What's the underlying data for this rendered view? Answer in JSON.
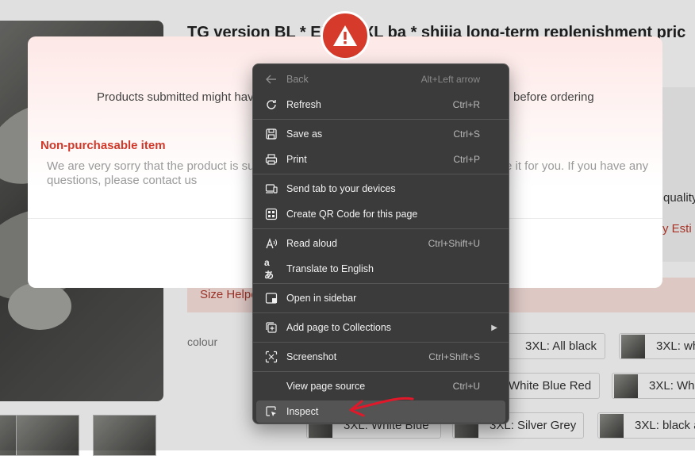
{
  "product": {
    "title": "TG version BL * ENI... 3XL ba * shijia long-term replenishment pric",
    "quality_fragment": "quality",
    "estimate_fragment": "ry Esti",
    "size_helper": "Size Helpe",
    "colour_label": "colour"
  },
  "variants": [
    {
      "label": "3XL: All black"
    },
    {
      "label": "3XL: wh"
    },
    {
      "label": "White Blue Red"
    },
    {
      "label": "3XL: Whi"
    },
    {
      "label": "3XL: White Blue"
    },
    {
      "label": "3XL: Silver Grey"
    },
    {
      "label": "3XL: black a"
    }
  ],
  "modal": {
    "message_left": "Products submitted might hav",
    "message_right": "before ordering",
    "heading": "Non-purchasable item",
    "body_left": "We are very sorry that the product is sus",
    "body_right": "e it for you. If you have any",
    "body_line2": "questions, please contact us"
  },
  "context_menu": {
    "items": [
      {
        "label": "Back",
        "shortcut": "Alt+Left arrow",
        "icon": "back-arrow-icon",
        "disabled": true
      },
      {
        "label": "Refresh",
        "shortcut": "Ctrl+R",
        "icon": "refresh-icon"
      },
      {
        "label": "Save as",
        "shortcut": "Ctrl+S",
        "icon": "save-icon"
      },
      {
        "label": "Print",
        "shortcut": "Ctrl+P",
        "icon": "print-icon"
      },
      {
        "label": "Send tab to your devices",
        "shortcut": "",
        "icon": "devices-icon"
      },
      {
        "label": "Create QR Code for this page",
        "shortcut": "",
        "icon": "qr-code-icon"
      },
      {
        "label": "Read aloud",
        "shortcut": "Ctrl+Shift+U",
        "icon": "read-aloud-icon"
      },
      {
        "label": "Translate to English",
        "shortcut": "",
        "icon": "translate-icon"
      },
      {
        "label": "Open in sidebar",
        "shortcut": "",
        "icon": "sidebar-icon"
      },
      {
        "label": "Add page to Collections",
        "shortcut": "",
        "icon": "collections-icon",
        "submenu": true
      },
      {
        "label": "Screenshot",
        "shortcut": "Ctrl+Shift+S",
        "icon": "screenshot-icon"
      },
      {
        "label": "View page source",
        "shortcut": "Ctrl+U",
        "icon": ""
      },
      {
        "label": "Inspect",
        "shortcut": "",
        "icon": "inspect-icon",
        "highlighted": true
      }
    ]
  },
  "colors": {
    "menu_bg": "#3b3b3b",
    "menu_hover": "#545454",
    "warning_red": "#d63a2a",
    "heading_red": "#d0392a",
    "annotation_red": "#e0182a"
  }
}
